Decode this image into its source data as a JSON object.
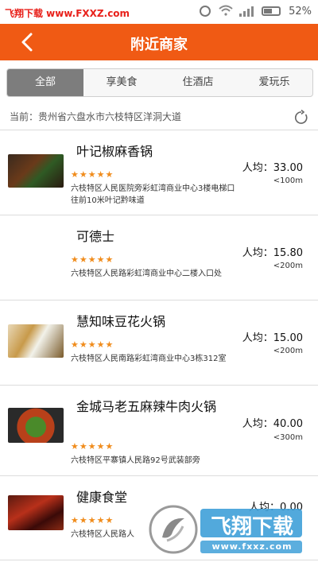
{
  "status_bar": {
    "watermark": "飞翔下载 www.FXXZ.com",
    "battery": "52%"
  },
  "header": {
    "title": "附近商家"
  },
  "tabs": [
    {
      "label": "全部",
      "active": true
    },
    {
      "label": "享美食",
      "active": false
    },
    {
      "label": "住酒店",
      "active": false
    },
    {
      "label": "爱玩乐",
      "active": false
    }
  ],
  "location": {
    "text": "当前：贵州省六盘水市六枝特区洋洞大道"
  },
  "merchants": [
    {
      "name": "叶记椒麻香锅",
      "stars": "★★★★★",
      "address": "六枝特区人民医院旁彩虹湾商业中心3楼电梯口往前10米叶记黔味道",
      "price": "人均：33.00",
      "distance": "<100m"
    },
    {
      "name": "可德士",
      "stars": "★★★★★",
      "address": "六枝特区人民路彩虹湾商业中心二楼入口处",
      "price": "人均：15.80",
      "distance": "<200m"
    },
    {
      "name": "慧知味豆花火锅",
      "stars": "★★★★★",
      "address": "六枝特区人民南路彩虹湾商业中心3栋312室",
      "price": "人均：15.00",
      "distance": "<200m"
    },
    {
      "name": "金城马老五麻辣牛肉火锅",
      "stars": "★★★★★",
      "address": "六枝特区平寨镇人民路92号武装部旁",
      "price": "人均：40.00",
      "distance": "<300m"
    },
    {
      "name": "健康食堂",
      "stars": "★★★★★",
      "address": "六枝特区人民路人",
      "price": "人均：0.00",
      "distance": ""
    }
  ],
  "watermark_bottom": {
    "brand": "飞翔下载",
    "url": "www.fxxz.com"
  }
}
